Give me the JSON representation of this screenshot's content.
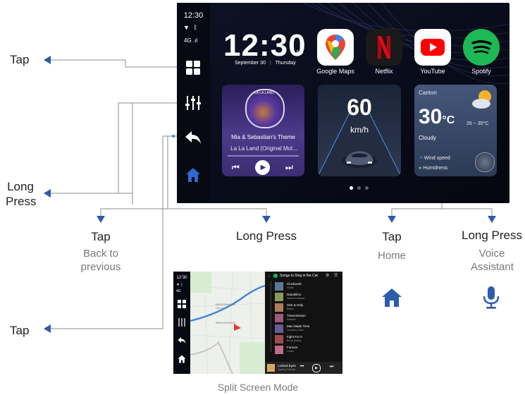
{
  "main_screen": {
    "status": {
      "time": "12:30",
      "network": "4G"
    },
    "clock": {
      "time": "12:30",
      "ampm": "AM",
      "date": "September 30",
      "day": "Thursday"
    },
    "apps": [
      {
        "label": "Google Maps",
        "icon": "google-maps-icon"
      },
      {
        "label": "Netflix",
        "icon": "netflix-icon"
      },
      {
        "label": "YouTube",
        "icon": "youtube-icon"
      },
      {
        "label": "Spotify",
        "icon": "spotify-icon"
      }
    ],
    "music": {
      "album_text": "LA LA LAND",
      "title": "Mia & Sebastian's Theme",
      "subtitle": "La La Land (Original Mot..."
    },
    "speed": {
      "value": "60",
      "unit": "km/h"
    },
    "weather": {
      "city": "Canton",
      "temp": "30",
      "unit": "°C",
      "range": "26 ~ 35°C",
      "condition": "Cloudy",
      "wind_label": "Wind speed",
      "humidity_label": "Humidness"
    }
  },
  "annotations": {
    "tap_top": "Tap",
    "long_press_left": "Long Press",
    "tap_bottom": "Tap",
    "back_tap": "Tap",
    "back_tap_desc": "Back to previous",
    "back_long": "Long Press",
    "home_tap": "Tap",
    "home_tap_desc": "Home",
    "home_long": "Long Press",
    "home_long_desc": "Voice Assistant"
  },
  "split_screen": {
    "caption": "Split Screen Mode",
    "status_time": "12:30",
    "status_network": "4G",
    "playlist_title": "Songs to Sing in the Car",
    "map_labels": [
      "BRIDGEWOOD HILLS",
      "BRIDGEWOOD"
    ],
    "songs": [
      {
        "title": "Clockwork",
        "artist": "Hozier"
      },
      {
        "title": "Dandelion",
        "artist": "Serena Harrison"
      },
      {
        "title": "One & Only",
        "artist": "Beaux"
      },
      {
        "title": "Transmission",
        "artist": "Sadface"
      },
      {
        "title": "Man Made Time",
        "artist": "Courtney Davis"
      },
      {
        "title": "Fight For It",
        "artist": "Brave Ashley"
      },
      {
        "title": "Forever",
        "artist": "Lewdo"
      }
    ],
    "now_playing": {
      "title": "Locked Eyes",
      "artist": "Mystery Friends"
    }
  },
  "colors": {
    "accent_blue": "#2c5cab",
    "line_gray": "#8c8c8c",
    "spotify_green": "#1db954",
    "youtube_red": "#ff0000",
    "netflix_red": "#e50914"
  }
}
